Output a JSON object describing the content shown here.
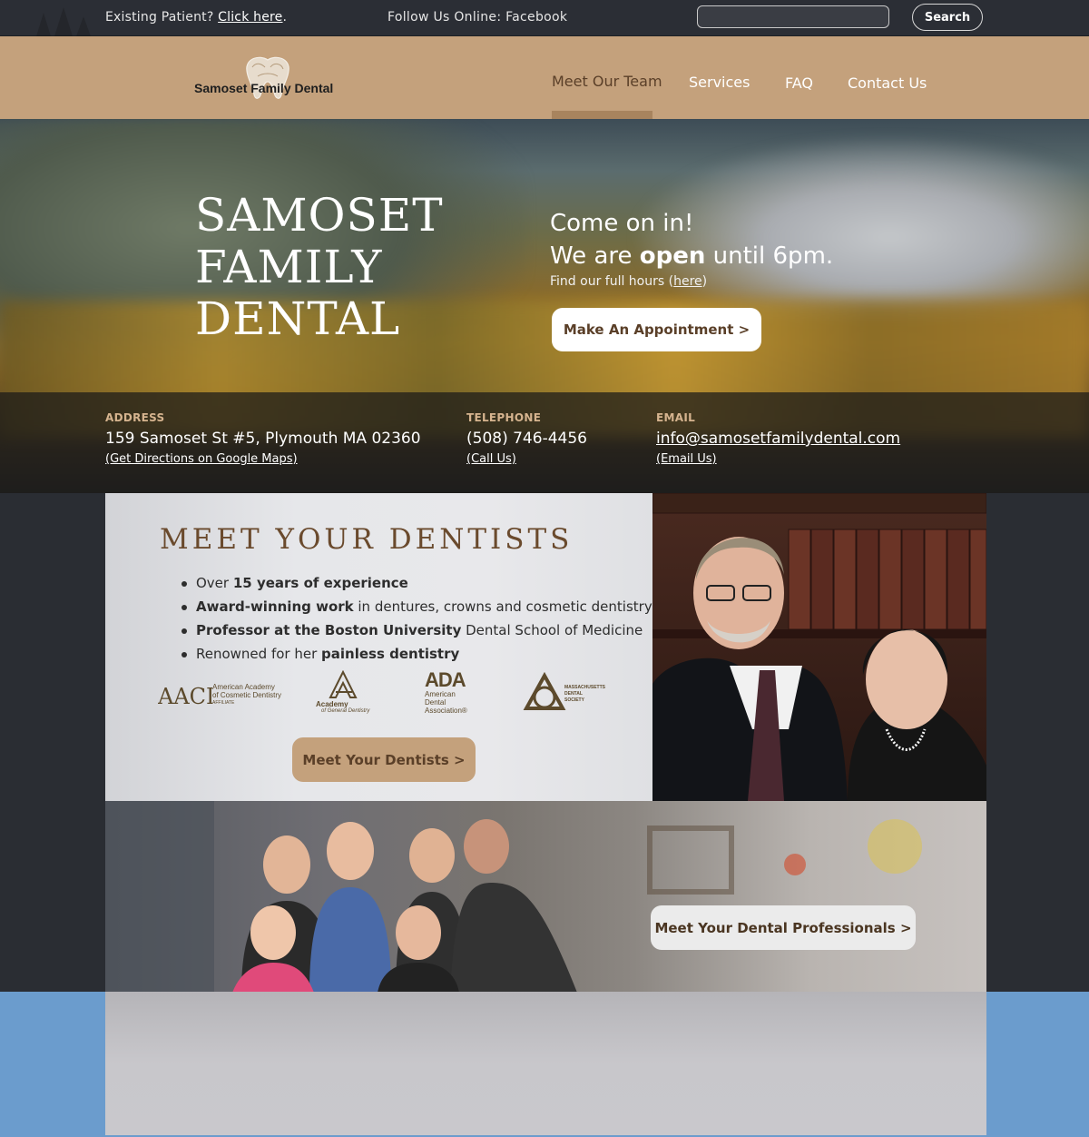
{
  "topbar": {
    "patient_prefix": "Existing Patient?",
    "patient_link": "Click here",
    "patient_suffix": ".",
    "follow": "Follow Us Online: Facebook",
    "search_value": "",
    "search_button": "Search"
  },
  "nav": {
    "logo_text": "Samoset Family Dental",
    "items": [
      {
        "label": "Meet Our Team",
        "active": true
      },
      {
        "label": "Services",
        "active": false
      },
      {
        "label": "FAQ",
        "active": false
      },
      {
        "label": "Contact Us",
        "active": false
      }
    ],
    "colors": {
      "bar": "#c4a17c",
      "active_text": "#5a3f28"
    }
  },
  "hero": {
    "title_lines": [
      "SAMOSET",
      "FAMILY",
      "DENTAL"
    ],
    "come": "Come on in!",
    "open_prefix": "We are ",
    "open_bold": "open",
    "open_suffix": " until 6pm.",
    "hours_prefix": "Find our full hours (",
    "hours_link": "here",
    "hours_suffix": ")",
    "appointment_button": "Make An Appointment >"
  },
  "contact": {
    "address": {
      "label": "ADDRESS",
      "value": "159 Samoset St #5, Plymouth MA 02360",
      "link": "(Get Directions on Google Maps)"
    },
    "telephone": {
      "label": "TELEPHONE",
      "value": "(508) 746-4456",
      "link": "(Call Us)"
    },
    "email": {
      "label": "EMAIL",
      "value": "info@samosetfamilydental.com",
      "link": "(Email Us)"
    }
  },
  "dentists": {
    "title": "MEET YOUR DENTISTS",
    "bullets": [
      {
        "pre": "Over ",
        "bold": "15 years of experience",
        "post": ""
      },
      {
        "pre": "",
        "bold": "Award-winning work",
        "post": " in dentures, crowns and cosmetic dentistry"
      },
      {
        "pre": "",
        "bold": "Professor at the Boston University",
        "post": " Dental School of Medicine"
      },
      {
        "pre": "Renowned for her ",
        "bold": "painless dentistry",
        "post": ""
      }
    ],
    "logos": {
      "aacd_line1": "American Academy",
      "aacd_line2": "of Cosmetic Dentistry",
      "aacd_line3": "AFFILIATE",
      "agd_line1": "Academy",
      "agd_line2": "of General Dentistry",
      "ada": "ADA",
      "ada_line1": "American",
      "ada_line2": "Dental",
      "ada_line3": "Association®",
      "mds_line1": "Massachusetts",
      "mds_line2": "Dental",
      "mds_line3": "Society"
    },
    "button": "Meet Your Dentists >"
  },
  "team": {
    "button": "Meet Your Dental Professionals >"
  },
  "colors": {
    "accent_tan": "#c4a17c",
    "brown_text": "#5a3f28",
    "contact_label": "#d6b48f",
    "bottom_blue": "#6b9ccd"
  }
}
